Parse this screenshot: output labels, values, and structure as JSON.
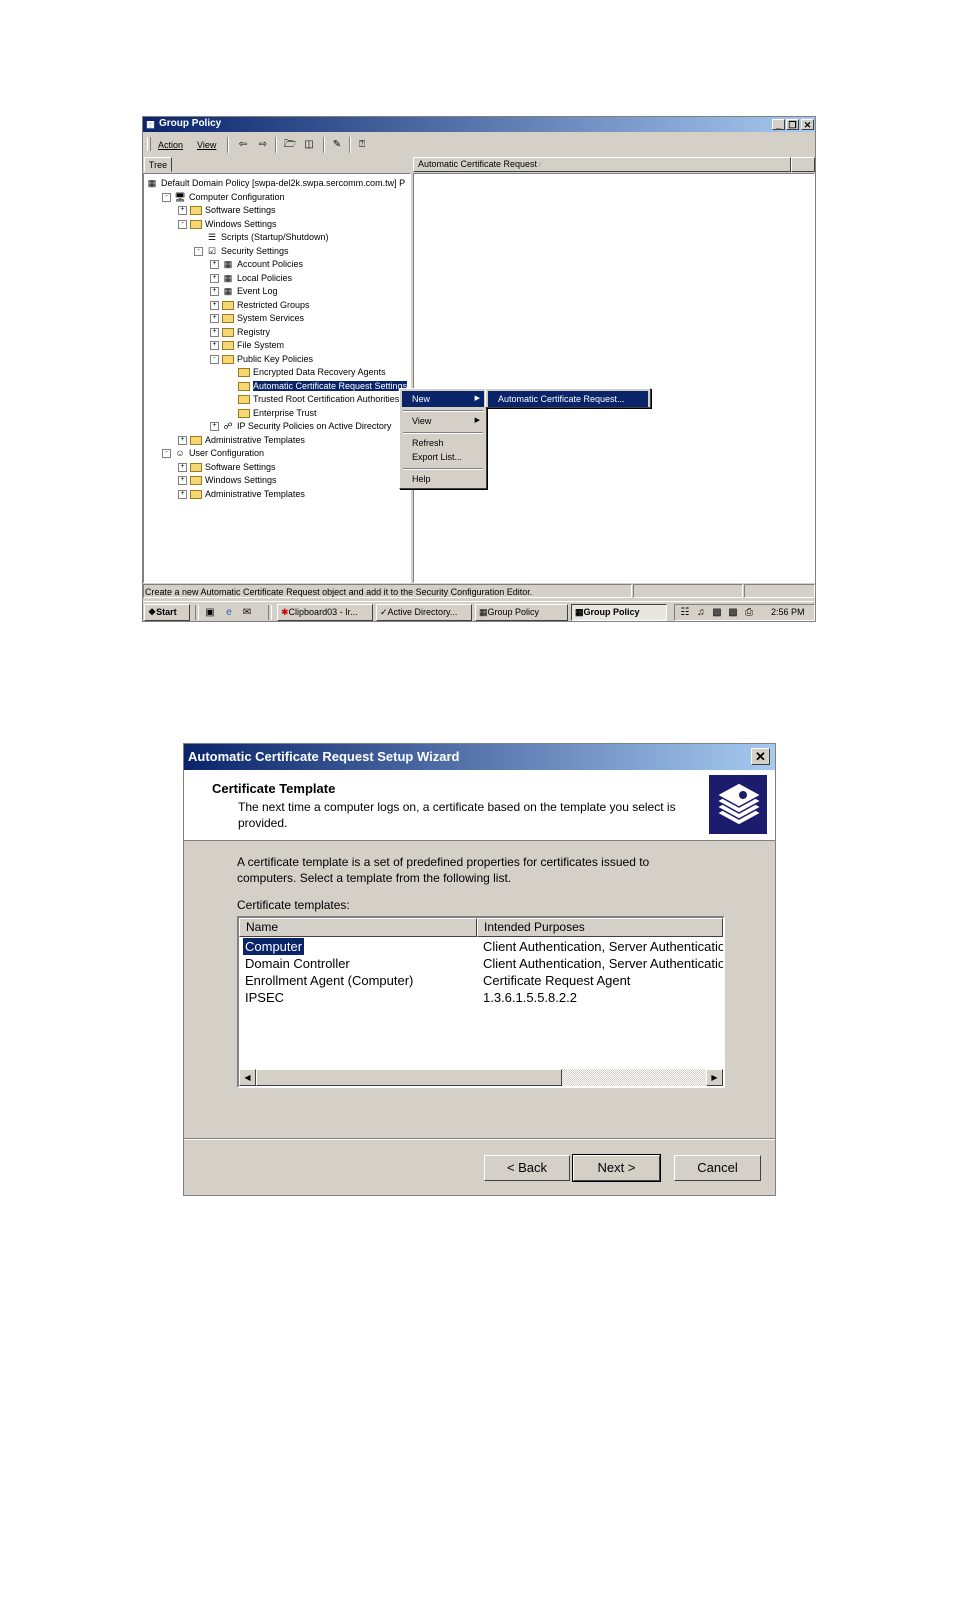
{
  "group_policy": {
    "window_title": "Group Policy",
    "menu": {
      "action": "Action",
      "view": "View"
    },
    "tree_tab": "Tree",
    "column_header": "Automatic Certificate Request",
    "tree": [
      {
        "label": "Default Domain Policy [swpa-del2k.swpa.sercomm.com.tw] P",
        "level": 0,
        "expander": "",
        "icon": "policy"
      },
      {
        "label": "Computer Configuration",
        "level": 1,
        "expander": "-",
        "icon": "computer"
      },
      {
        "label": "Software Settings",
        "level": 2,
        "expander": "+",
        "icon": "folder"
      },
      {
        "label": "Windows Settings",
        "level": 2,
        "expander": "-",
        "icon": "folder"
      },
      {
        "label": "Scripts (Startup/Shutdown)",
        "level": 3,
        "expander": "",
        "icon": "script"
      },
      {
        "label": "Security Settings",
        "level": 3,
        "expander": "-",
        "icon": "security"
      },
      {
        "label": "Account Policies",
        "level": 4,
        "expander": "+",
        "icon": "policy"
      },
      {
        "label": "Local Policies",
        "level": 4,
        "expander": "+",
        "icon": "policy"
      },
      {
        "label": "Event Log",
        "level": 4,
        "expander": "+",
        "icon": "policy"
      },
      {
        "label": "Restricted Groups",
        "level": 4,
        "expander": "+",
        "icon": "folder"
      },
      {
        "label": "System Services",
        "level": 4,
        "expander": "+",
        "icon": "folder"
      },
      {
        "label": "Registry",
        "level": 4,
        "expander": "+",
        "icon": "folder"
      },
      {
        "label": "File System",
        "level": 4,
        "expander": "+",
        "icon": "folder"
      },
      {
        "label": "Public Key Policies",
        "level": 4,
        "expander": "-",
        "icon": "folder"
      },
      {
        "label": "Encrypted Data Recovery Agents",
        "level": 5,
        "expander": "",
        "icon": "folder"
      },
      {
        "label": "Automatic Certificate Request Settings",
        "level": 5,
        "expander": "",
        "icon": "folder",
        "selected": true
      },
      {
        "label": "Trusted Root Certification Authorities",
        "level": 5,
        "expander": "",
        "icon": "folder"
      },
      {
        "label": "Enterprise Trust",
        "level": 5,
        "expander": "",
        "icon": "folder"
      },
      {
        "label": "IP Security Policies on Active Directory",
        "level": 4,
        "expander": "+",
        "icon": "ipsec"
      },
      {
        "label": "Administrative Templates",
        "level": 2,
        "expander": "+",
        "icon": "folder"
      },
      {
        "label": "User Configuration",
        "level": 1,
        "expander": "-",
        "icon": "user"
      },
      {
        "label": "Software Settings",
        "level": 2,
        "expander": "+",
        "icon": "folder"
      },
      {
        "label": "Windows Settings",
        "level": 2,
        "expander": "+",
        "icon": "folder"
      },
      {
        "label": "Administrative Templates",
        "level": 2,
        "expander": "+",
        "icon": "folder"
      }
    ],
    "context_menu": {
      "new": "New",
      "view": "View",
      "refresh": "Refresh",
      "export_list": "Export List...",
      "help": "Help"
    },
    "submenu": {
      "item": "Automatic Certificate Request..."
    },
    "status_text": "Create a new Automatic Certificate Request object and add it to the Security Configuration Editor.",
    "taskbar": {
      "start": "Start",
      "buttons": [
        "Clipboard03 - Ir...",
        "Active Directory...",
        "Group Policy",
        "Group Policy"
      ],
      "clock": "2:56 PM"
    }
  },
  "wizard": {
    "title": "Automatic Certificate Request Setup Wizard",
    "header_title": "Certificate Template",
    "header_desc_line1": "The next time a computer logs on, a certificate based on the template you select is",
    "header_desc_line2": "provided.",
    "body_line1": "A certificate template is a set of predefined properties for certificates issued to",
    "body_line2": "computers. Select a template from the following list.",
    "list_label": "Certificate templates:",
    "columns": [
      "Name",
      "Intended Purposes"
    ],
    "rows": [
      {
        "name": "Computer",
        "purposes": "Client Authentication, Server Authentication",
        "selected": true
      },
      {
        "name": "Domain Controller",
        "purposes": "Client Authentication, Server Authentication"
      },
      {
        "name": "Enrollment Agent (Computer)",
        "purposes": "Certificate Request Agent"
      },
      {
        "name": "IPSEC",
        "purposes": "1.3.6.1.5.5.8.2.2"
      }
    ],
    "buttons": {
      "back": "< Back",
      "next": "Next >",
      "cancel": "Cancel"
    }
  },
  "icons": {
    "app": "group-policy-icon",
    "wizard_header": "certificate-stack-icon",
    "colors": {
      "title_start": "#0a246a",
      "title_end": "#a6caf0",
      "selection": "#0a246a"
    }
  }
}
